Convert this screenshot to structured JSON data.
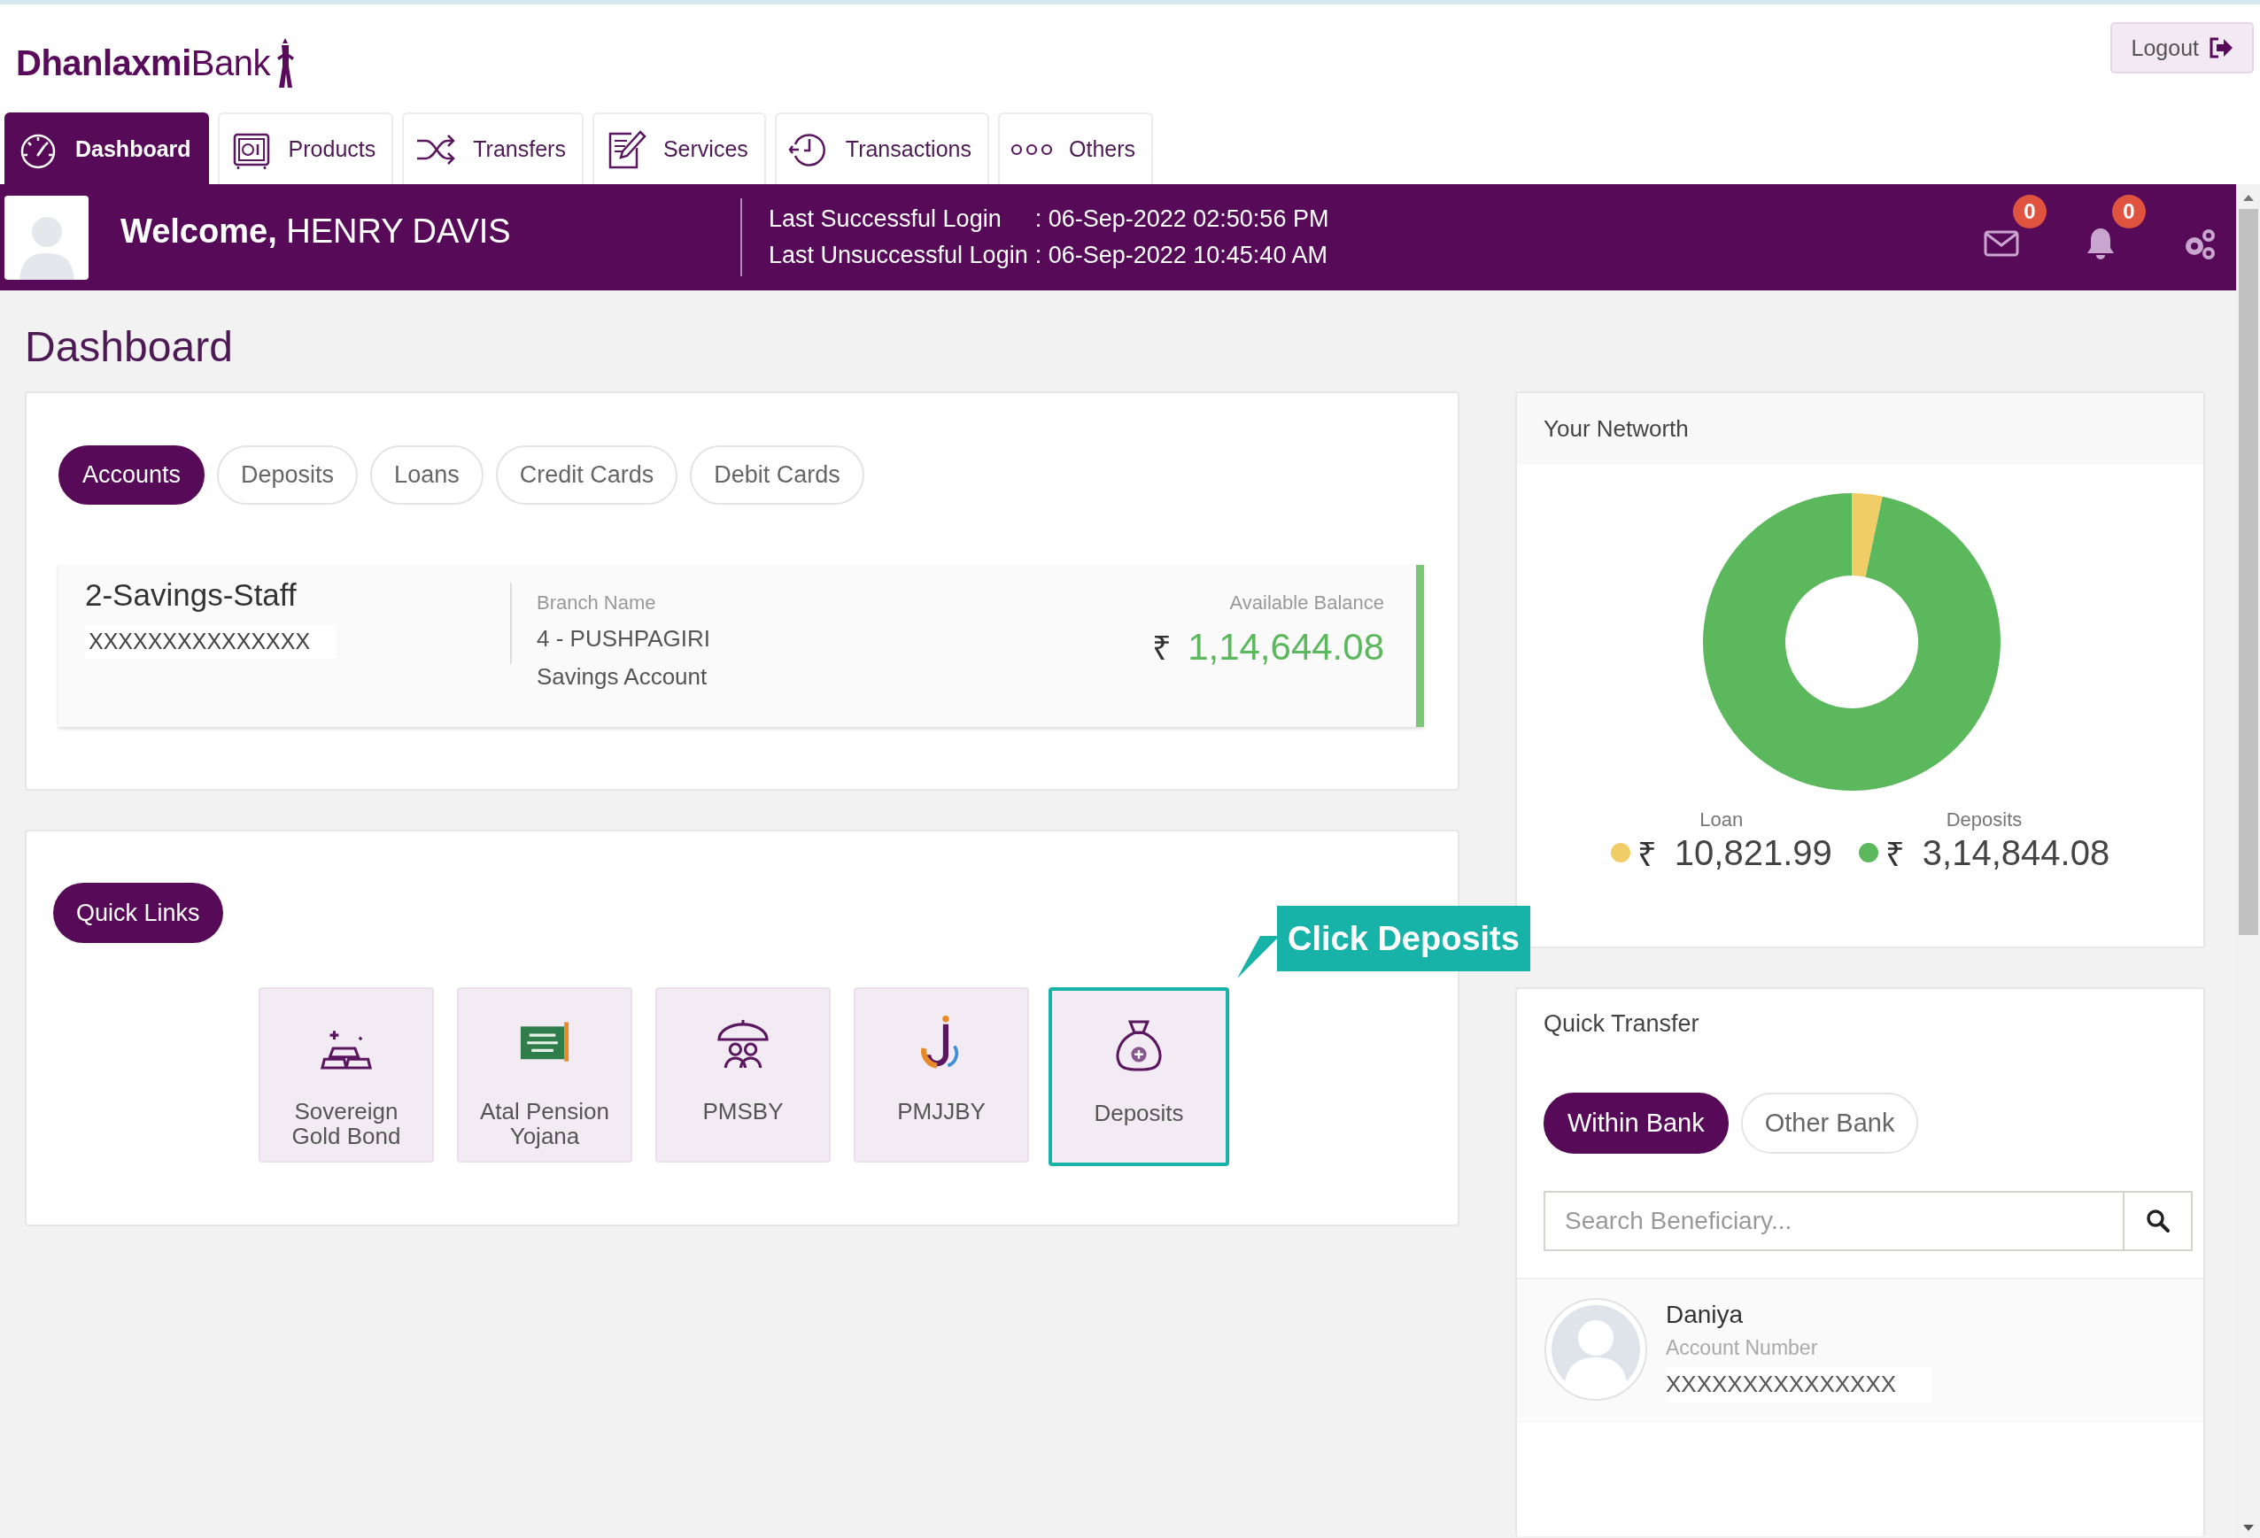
{
  "header": {
    "logo": "**Dhanlaxmi**Bank",
    "logout": "Logout"
  },
  "nav": [
    {
      "label": "Dashboard",
      "selected": true
    },
    {
      "label": "Products",
      "selected": false
    },
    {
      "label": "Transfers",
      "selected": false
    },
    {
      "label": "Services",
      "selected": false
    },
    {
      "label": "Transactions",
      "selected": false
    },
    {
      "label": "Others",
      "selected": false
    }
  ],
  "welcome": {
    "greeting": "**Welcome,** HENRY DAVIS",
    "logins": [
      {
        "label": "Last Successful Login",
        "value": ": 06-Sep-2022 02:50:56 PM"
      },
      {
        "label": "Last Unsuccessful Login",
        "value": ": 06-Sep-2022 10:45:40 AM"
      }
    ],
    "messages_count": "0",
    "notifications_count": "0"
  },
  "page_title": "Dashboard",
  "account_tabs": [
    {
      "label": "Accounts",
      "selected": true
    },
    {
      "label": "Deposits",
      "selected": false
    },
    {
      "label": "Loans",
      "selected": false
    },
    {
      "label": "Credit Cards",
      "selected": false
    },
    {
      "label": "Debit Cards",
      "selected": false
    }
  ],
  "account": {
    "name": "2-Savings-Staff",
    "number": "XXXXXXXXXXXXXXX",
    "branch_label": "Branch Name",
    "branch": "4 - PUSHPAGIRI",
    "type": "Savings Account",
    "balance_label": "Available Balance",
    "currency": "₹",
    "balance": "1,14,644.08"
  },
  "quick_links": {
    "title": "Quick Links",
    "items": [
      {
        "label": "Sovereign Gold Bond",
        "highlighted": false
      },
      {
        "label": "Atal Pension Yojana",
        "highlighted": false
      },
      {
        "label": "PMSBY",
        "highlighted": false
      },
      {
        "label": "PMJJBY",
        "highlighted": false
      },
      {
        "label": "Deposits",
        "highlighted": true
      }
    ]
  },
  "callout": "Click Deposits",
  "networth": {
    "title": "Your Networth",
    "chart_data": {
      "type": "donut",
      "categories": [
        "Loan",
        "Deposits"
      ],
      "values": [
        3.32,
        96.68
      ]
    },
    "legend": [
      {
        "currency": "₹",
        "amount": "10,821.99",
        "color": "#f0cd66"
      },
      {
        "currency": "₹",
        "amount": "3,14,844.08",
        "color": "#5cb85c"
      }
    ]
  },
  "quick_transfer": {
    "title": "Quick Transfer",
    "tabs": [
      {
        "label": "Within Bank",
        "selected": true
      },
      {
        "label": "Other Bank",
        "selected": false
      }
    ],
    "search": {
      "placeholder": "Search Beneficiary..."
    },
    "beneficiaries": [
      {
        "name": "Daniya",
        "number_label": "Account Number",
        "number": "XXXXXXXXXXXXXXX"
      }
    ]
  }
}
